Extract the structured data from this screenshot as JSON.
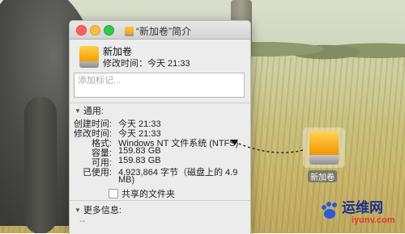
{
  "window": {
    "title": "“新加卷”简介"
  },
  "header": {
    "volume_name": "新加卷",
    "modified": "修改时间：今天 21:33"
  },
  "tags": {
    "placeholder": "添加标记..."
  },
  "general": {
    "label": "通用:",
    "rows": [
      {
        "key": "创建时间:",
        "value": "今天 21:33"
      },
      {
        "key": "修改时间:",
        "value": "今天 21:33"
      },
      {
        "key": "格式:",
        "value": "Windows NT 文件系统 (NTFS)"
      },
      {
        "key": "容量:",
        "value": "159.83 GB"
      },
      {
        "key": "可用:",
        "value": "159.83 GB"
      },
      {
        "key": "已使用:",
        "value": "4,923,864 字节（磁盘上的 4.9"
      },
      {
        "key": "",
        "value": "MB)"
      }
    ],
    "shared_folder_label": "共享的文件夹"
  },
  "more_info": {
    "label": "更多信息:",
    "placeholder": "--"
  },
  "desktop": {
    "volume_label": "新加卷"
  },
  "watermark": {
    "brand": "运维网",
    "url": "iyunv.com"
  },
  "colors": {
    "close": "#fc605c",
    "minimize": "#fdbc40",
    "zoom": "#34c84a",
    "drive": "#f5a300"
  }
}
